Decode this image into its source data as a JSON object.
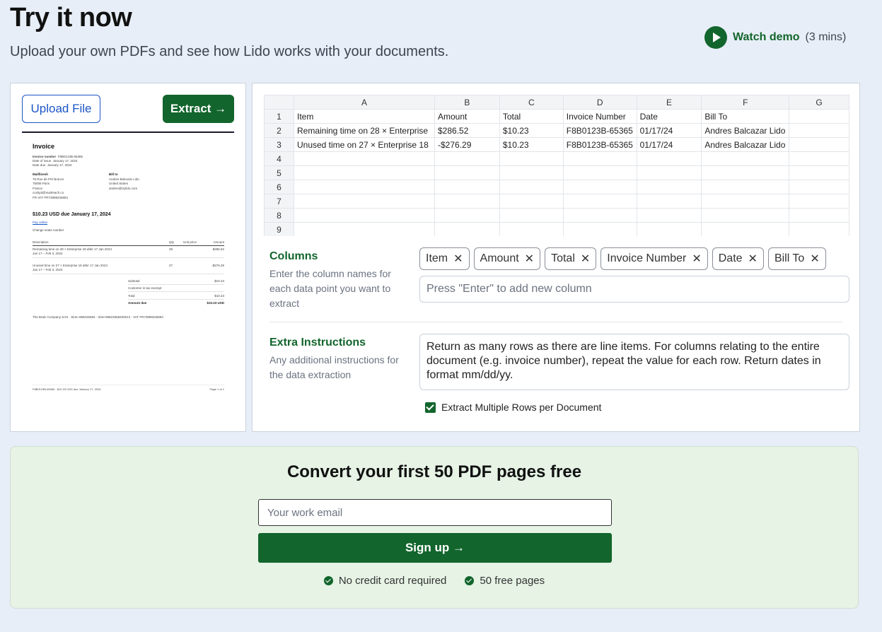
{
  "header": {
    "title": "Try it now",
    "subtitle": "Upload your own PDFs and see how Lido works with your documents.",
    "watch_demo": "Watch demo",
    "watch_demo_duration": "(3 mins)"
  },
  "left": {
    "upload_label": "Upload File",
    "extract_label": "Extract →",
    "doc": {
      "title": "Invoice",
      "meta": [
        [
          "Invoice number",
          "F8B0123B-65365"
        ],
        [
          "Date of issue",
          "January 17, 2024"
        ],
        [
          "Date due",
          "January 17, 2024"
        ]
      ],
      "from_name": "Mailfinesh",
      "from_lines": [
        "76 Rue de Pré Brancs",
        "75008 Paris",
        "France",
        "cockpit@mailreach.co",
        "FR VAT FR73898225684"
      ],
      "bill_to_label": "Bill to",
      "bill_to_lines": [
        "Andres Balcazar Lido",
        "United States",
        "andres@trylido.com"
      ],
      "due_line": "$10.23 USD due January 17, 2024",
      "pay_online": "Pay online",
      "note": "Change seats number",
      "table_headers": [
        "Description",
        "Qty",
        "Unit price",
        "Amount"
      ],
      "rows": [
        {
          "desc": "Remaining time on 28 × Enterprise 18 after 17 Jan 2024",
          "sub": "Jan 17 – Feb 3, 2024",
          "qty": "28",
          "amount": "$286.52"
        },
        {
          "desc": "Unused time on 27 × Enterprise 18 after 17 Jan 2024",
          "sub": "Jan 17 – Feb 3, 2024",
          "qty": "27",
          "amount": "-$276.29"
        }
      ],
      "totals": [
        [
          "Subtotal",
          "$10.23"
        ],
        [
          "Customer is tax exempt",
          ""
        ],
        [
          "Total",
          "$10.23"
        ],
        [
          "Amount due",
          "$10.23 USD"
        ]
      ],
      "footer_company": "The Brain Company SAS · Siren 898225684 · Siret 89822568400013 · VAT FR73898225684",
      "footer_left": "F8B0123B-65365 · $10.23 USD due January 17, 2024",
      "footer_right": "Page 1 of 1"
    }
  },
  "sheet": {
    "columns": [
      "A",
      "B",
      "C",
      "D",
      "E",
      "F",
      "G"
    ],
    "row_numbers": [
      "1",
      "2",
      "3",
      "4",
      "5",
      "6",
      "7",
      "8",
      "9"
    ],
    "rows": [
      [
        "Item",
        "Amount",
        "Total",
        "Invoice Number",
        "Date",
        "Bill To",
        ""
      ],
      [
        "Remaining time on 28 × Enterprise",
        "$286.52",
        "$10.23",
        "F8B0123B-65365",
        "01/17/24",
        "Andres Balcazar Lido",
        ""
      ],
      [
        "Unused time on 27 × Enterprise 18",
        "-$276.29",
        "$10.23",
        "F8B0123B-65365",
        "01/17/24",
        "Andres Balcazar Lido",
        ""
      ],
      [
        "",
        "",
        "",
        "",
        "",
        "",
        ""
      ],
      [
        "",
        "",
        "",
        "",
        "",
        "",
        ""
      ],
      [
        "",
        "",
        "",
        "",
        "",
        "",
        ""
      ],
      [
        "",
        "",
        "",
        "",
        "",
        "",
        ""
      ],
      [
        "",
        "",
        "",
        "",
        "",
        "",
        ""
      ],
      [
        "",
        "",
        "",
        "",
        "",
        "",
        ""
      ]
    ]
  },
  "columns_section": {
    "title": "Columns",
    "description": "Enter the column names for each data point you want to extract",
    "chips": [
      "Item",
      "Amount",
      "Total",
      "Invoice Number",
      "Date",
      "Bill To"
    ],
    "placeholder": "Press \"Enter\" to add new column"
  },
  "instructions_section": {
    "title": "Extra Instructions",
    "description": "Any additional instructions for the data extraction",
    "value": "Return as many rows as there are line items. For columns relating to the entire document (e.g. invoice number), repeat the value for each row. Return dates in format mm/dd/yy.",
    "checkbox_label": "Extract Multiple Rows per Document",
    "checkbox_checked": true
  },
  "signup": {
    "title": "Convert your first 50 PDF pages free",
    "email_placeholder": "Your work email",
    "button": "Sign up →",
    "perks": [
      "No credit card required",
      "50 free pages"
    ]
  },
  "colors": {
    "brand_green": "#12652c",
    "link_blue": "#1b55c7",
    "page_bg": "#e8eef7",
    "signup_bg": "#e6f3e5"
  }
}
